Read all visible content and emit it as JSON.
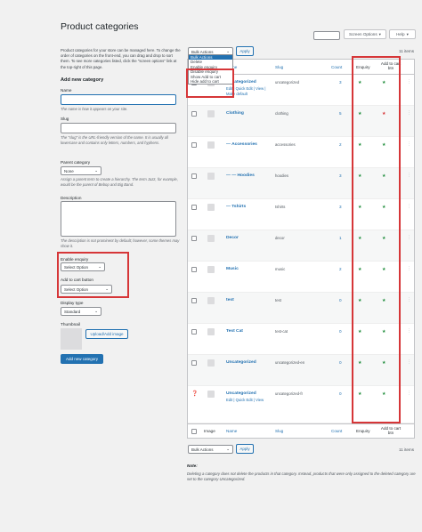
{
  "page": {
    "title": "Product categories",
    "screen_options": "Screen Options",
    "help": "Help",
    "description": "Product categories for your store can be managed here. To change the order of categories on the front-end, you can drag and drop to sort them. To see more categories listed, click the \"screen options\" link at the top-right of this page."
  },
  "form": {
    "heading": "Add new category",
    "name_label": "Name",
    "name_hint": "The name is how it appears on your site.",
    "slug_label": "Slug",
    "slug_hint": "The \"slug\" is the URL-friendly version of the name. It is usually all lowercase and contains only letters, numbers, and hyphens.",
    "parent_label": "Parent category",
    "parent_value": "None",
    "parent_hint": "Assign a parent term to create a hierarchy. The term Jazz, for example, would be the parent of Bebop and Big Band.",
    "description_label": "Description",
    "description_hint": "The description is not prominent by default; however, some themes may show it.",
    "enable_enquiry_label": "Enable enquiry",
    "enable_enquiry_value": "Select Option",
    "add_to_cart_label": "Add to cart button",
    "add_to_cart_value": "Select Option",
    "display_type_label": "Display type",
    "display_type_value": "Standard",
    "thumbnail_label": "Thumbnail",
    "upload_button": "Upload/Add image",
    "submit_button": "Add new category"
  },
  "bulk": {
    "selected": "Bulk Actions",
    "apply": "Apply",
    "options": [
      "Bulk Actions",
      "Delete",
      "Enable enquiry",
      "Disable enquiry",
      "Show Add to cart",
      "Hide add to cart"
    ],
    "items_count": "11 items"
  },
  "table": {
    "headers": {
      "image": "Image",
      "name": "Name",
      "slug": "Slug",
      "count": "Count",
      "enquiry": "Enquiry",
      "add_to_cart": "Add to cart btn"
    },
    "rows": [
      {
        "name": "Uncategorized",
        "slug": "uncategorized",
        "count": "3",
        "actions": [
          "Edit",
          "Quick Edit",
          "View",
          "Make default"
        ],
        "enquiry": "green",
        "cart": "green"
      },
      {
        "name": "Clothing",
        "slug": "clothing",
        "count": "5",
        "enquiry": "green",
        "cart": "red"
      },
      {
        "name": "— Accessories",
        "slug": "accessories",
        "count": "2",
        "enquiry": "green",
        "cart": "green"
      },
      {
        "name": "— — Hoodies",
        "slug": "hoodies",
        "count": "3",
        "enquiry": "green",
        "cart": "green"
      },
      {
        "name": "— Tshirts",
        "slug": "tshirts",
        "count": "3",
        "enquiry": "green",
        "cart": "green"
      },
      {
        "name": "Decor",
        "slug": "decor",
        "count": "1",
        "enquiry": "green",
        "cart": "green"
      },
      {
        "name": "Music",
        "slug": "music",
        "count": "2",
        "enquiry": "green",
        "cart": "green"
      },
      {
        "name": "test",
        "slug": "test",
        "count": "0",
        "enquiry": "green",
        "cart": "green"
      },
      {
        "name": "Test Cat",
        "slug": "test-cat",
        "count": "0",
        "enquiry": "green",
        "cart": "green"
      },
      {
        "name": "Uncategorized",
        "slug": "uncategorized-en",
        "count": "0",
        "enquiry": "green",
        "cart": "green"
      },
      {
        "name": "Uncategorized",
        "slug": "uncategorized-fr",
        "count": "0",
        "actions": [
          "Edit",
          "Quick Edit",
          "View"
        ],
        "enquiry": "green",
        "cart": "green"
      }
    ]
  },
  "footer": {
    "bulk_selected": "Bulk Actions",
    "apply": "Apply",
    "items_count": "11 items",
    "note_title": "Note:",
    "note_text": "Deleting a category does not delete the products in that category. Instead, products that were only assigned to the deleted category are set to the category Uncategorized."
  },
  "colors": {
    "green": "#1e8c3a",
    "red": "#d63638",
    "link": "#2271b1"
  }
}
